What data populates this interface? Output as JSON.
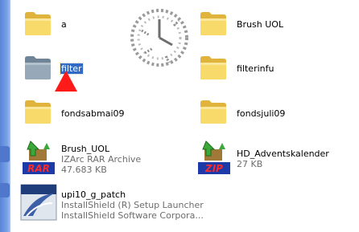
{
  "items": [
    {
      "name": "a",
      "type": "folder"
    },
    {
      "name": "Brush UOL",
      "type": "folder"
    },
    {
      "name": "filter",
      "type": "folder",
      "selected": true
    },
    {
      "name": "filterinfu",
      "type": "folder"
    },
    {
      "name": "fondsabmai09",
      "type": "folder"
    },
    {
      "name": "fondsjuli09",
      "type": "folder"
    },
    {
      "name": "Brush_UOL",
      "type": "rar-archive",
      "line2": "IZArc RAR Archive",
      "line3": "47.683 KB",
      "badge": "RAR"
    },
    {
      "name": "HD_Adventskalender",
      "type": "zip-archive",
      "line2": "27 KB",
      "badge": "ZIP"
    },
    {
      "name": "upi10_g_patch",
      "type": "setup-launcher",
      "line2": "InstallShield (R) Setup Launcher",
      "line3": "InstallShield Software Corpora..."
    }
  ],
  "colors": {
    "selection": "#316ac5",
    "folder": "#f5d35f",
    "marker": "#ff1a1a"
  }
}
